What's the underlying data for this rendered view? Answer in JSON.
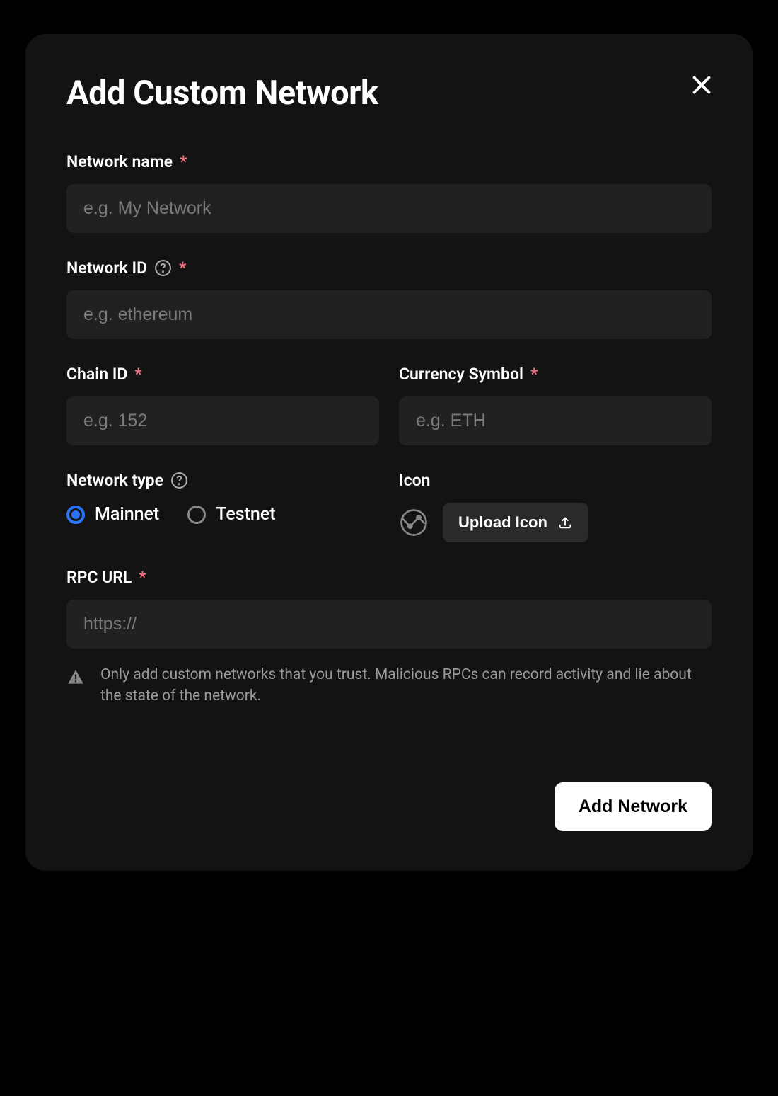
{
  "modal": {
    "title": "Add Custom Network"
  },
  "fields": {
    "network_name": {
      "label": "Network name",
      "placeholder": "e.g. My Network"
    },
    "network_id": {
      "label": "Network ID",
      "placeholder": "e.g. ethereum"
    },
    "chain_id": {
      "label": "Chain ID",
      "placeholder": "e.g. 152"
    },
    "currency_symbol": {
      "label": "Currency Symbol",
      "placeholder": "e.g. ETH"
    },
    "network_type": {
      "label": "Network type",
      "options": {
        "mainnet": "Mainnet",
        "testnet": "Testnet"
      }
    },
    "icon": {
      "label": "Icon",
      "upload_label": "Upload Icon"
    },
    "rpc_url": {
      "label": "RPC URL",
      "placeholder": "https://"
    }
  },
  "warning": {
    "text": "Only add custom networks that you trust. Malicious RPCs can record activity and lie about the state of the network."
  },
  "actions": {
    "submit": "Add Network"
  }
}
